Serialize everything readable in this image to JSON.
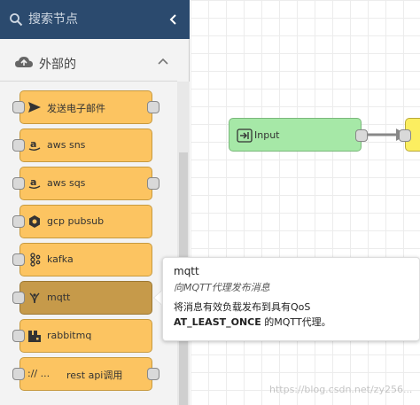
{
  "search": {
    "placeholder": "搜索节点",
    "collapse_glyph": "‹"
  },
  "category": {
    "label": "外部的",
    "icon": "cloud-upload-icon"
  },
  "palette_nodes": [
    {
      "label": "发送电子邮件",
      "icon": "send-icon"
    },
    {
      "label": "aws sns",
      "icon": "amazon-icon"
    },
    {
      "label": "aws sqs",
      "icon": "amazon-icon"
    },
    {
      "label": "gcp pubsub",
      "icon": "gcp-icon"
    },
    {
      "label": "kafka",
      "icon": "kafka-icon"
    },
    {
      "label": "mqtt",
      "icon": "mqtt-icon"
    },
    {
      "label": "rabbitmq",
      "icon": "rabbitmq-icon"
    },
    {
      "label": "rest api调用",
      "icon": "rest-icon",
      "icon_text": ":// ..."
    }
  ],
  "workspace": {
    "input_node": {
      "label": "Input",
      "icon": "input-icon"
    }
  },
  "tooltip": {
    "title": "mqtt",
    "subtitle": "向MQTT代理发布消息",
    "desc_line1": "将消息有效负载发布到具有QoS",
    "desc_line2_bold": "AT_LEAST_ONCE",
    "desc_line2_rest": " 的MQTT代理。"
  },
  "watermark": "https://blog.csdn.net/zy256...",
  "colors": {
    "header": "#2b4a6e",
    "node_orange": "#fcc461",
    "node_active": "#c69a4a",
    "input_green": "#a6e8a7",
    "next_yellow": "#fbee60"
  }
}
